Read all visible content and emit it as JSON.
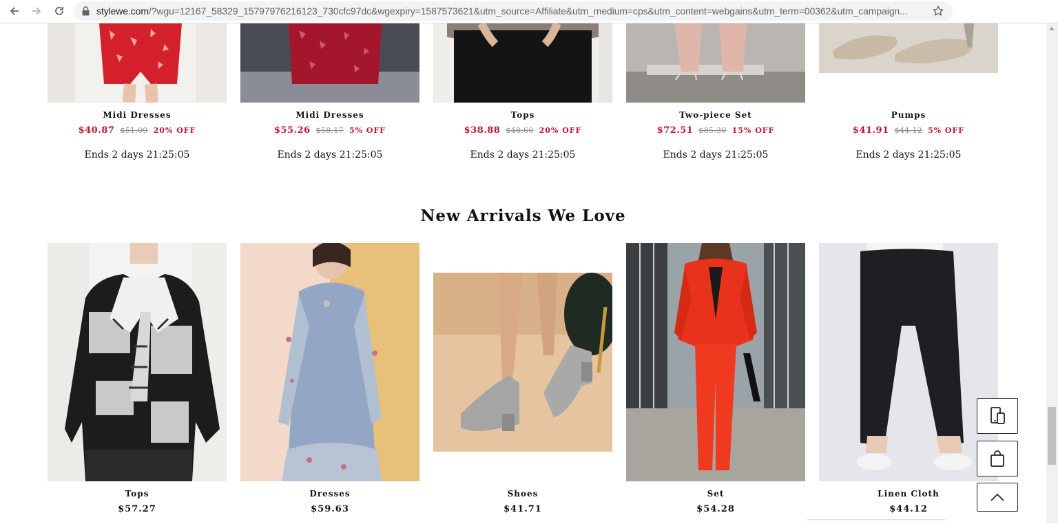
{
  "browser": {
    "url_domain": "stylewe.com",
    "url_rest": "/?wgu=12167_58329_15797976216123_730cfc97dc&wgexpiry=1587573621&utm_source=Affiliate&utm_medium=cps&utm_content=webgains&utm_term=00362&utm_campaign..."
  },
  "flash_sale": {
    "items": [
      {
        "name": "Midi Dresses",
        "price": "$40.87",
        "old_price": "$51.09",
        "off": "20% OFF",
        "countdown": "Ends 2 days 21:25:05"
      },
      {
        "name": "Midi Dresses",
        "price": "$55.26",
        "old_price": "$58.17",
        "off": "5% OFF",
        "countdown": "Ends 2 days 21:25:05"
      },
      {
        "name": "Tops",
        "price": "$38.88",
        "old_price": "$48.60",
        "off": "20% OFF",
        "countdown": "Ends 2 days 21:25:05"
      },
      {
        "name": "Two-piece Set",
        "price": "$72.51",
        "old_price": "$85.30",
        "off": "15% OFF",
        "countdown": "Ends 2 days 21:25:05"
      },
      {
        "name": "Pumps",
        "price": "$41.91",
        "old_price": "$44.12",
        "off": "5% OFF",
        "countdown": "Ends 2 days 21:25:05"
      }
    ]
  },
  "new_arrivals": {
    "title": "New Arrivals We Love",
    "items": [
      {
        "name": "Tops",
        "price": "$57.27"
      },
      {
        "name": "Dresses",
        "price": "$59.63"
      },
      {
        "name": "Shoes",
        "price": "$41.71"
      },
      {
        "name": "Set",
        "price": "$54.28"
      },
      {
        "name": "Linen Cloth",
        "price": "$44.12"
      }
    ]
  },
  "colors": {
    "sale_red": "#c8102e",
    "text": "#111111",
    "strike_gray": "#8a8a8a"
  },
  "icons": {
    "back": "arrow-left-icon",
    "forward": "arrow-right-icon",
    "reload": "reload-icon",
    "lock": "lock-icon",
    "bookmark": "star-icon",
    "app": "devices-icon",
    "bag": "shopping-bag-icon",
    "top": "chevron-up-icon"
  }
}
